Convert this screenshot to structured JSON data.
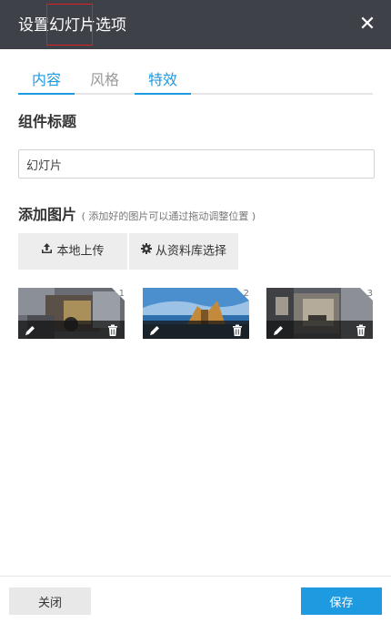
{
  "dialog": {
    "title": "设置幻灯片选项",
    "close_icon": "close-icon"
  },
  "tabs": [
    {
      "label": "内容",
      "active": true
    },
    {
      "label": "风格",
      "active": false
    },
    {
      "label": "特效",
      "active": true
    }
  ],
  "component_title": {
    "label": "组件标题",
    "value": "幻灯片"
  },
  "add_images": {
    "label": "添加图片",
    "hint": "( 添加好的图片可以通过拖动调整位置 )",
    "upload_label": "本地上传",
    "upload_icon": "upload-icon",
    "library_label": "从资料库选择",
    "library_icon": "gear-icon"
  },
  "images": [
    {
      "index": "1",
      "edit_icon": "pencil-icon",
      "delete_icon": "trash-icon"
    },
    {
      "index": "2",
      "edit_icon": "pencil-icon",
      "delete_icon": "trash-icon"
    },
    {
      "index": "3",
      "edit_icon": "pencil-icon",
      "delete_icon": "trash-icon"
    }
  ],
  "footer": {
    "close_label": "关闭",
    "save_label": "保存"
  },
  "colors": {
    "header_bg": "#3f4149",
    "accent": "#1e9ae0",
    "highlight": "#e02020"
  }
}
